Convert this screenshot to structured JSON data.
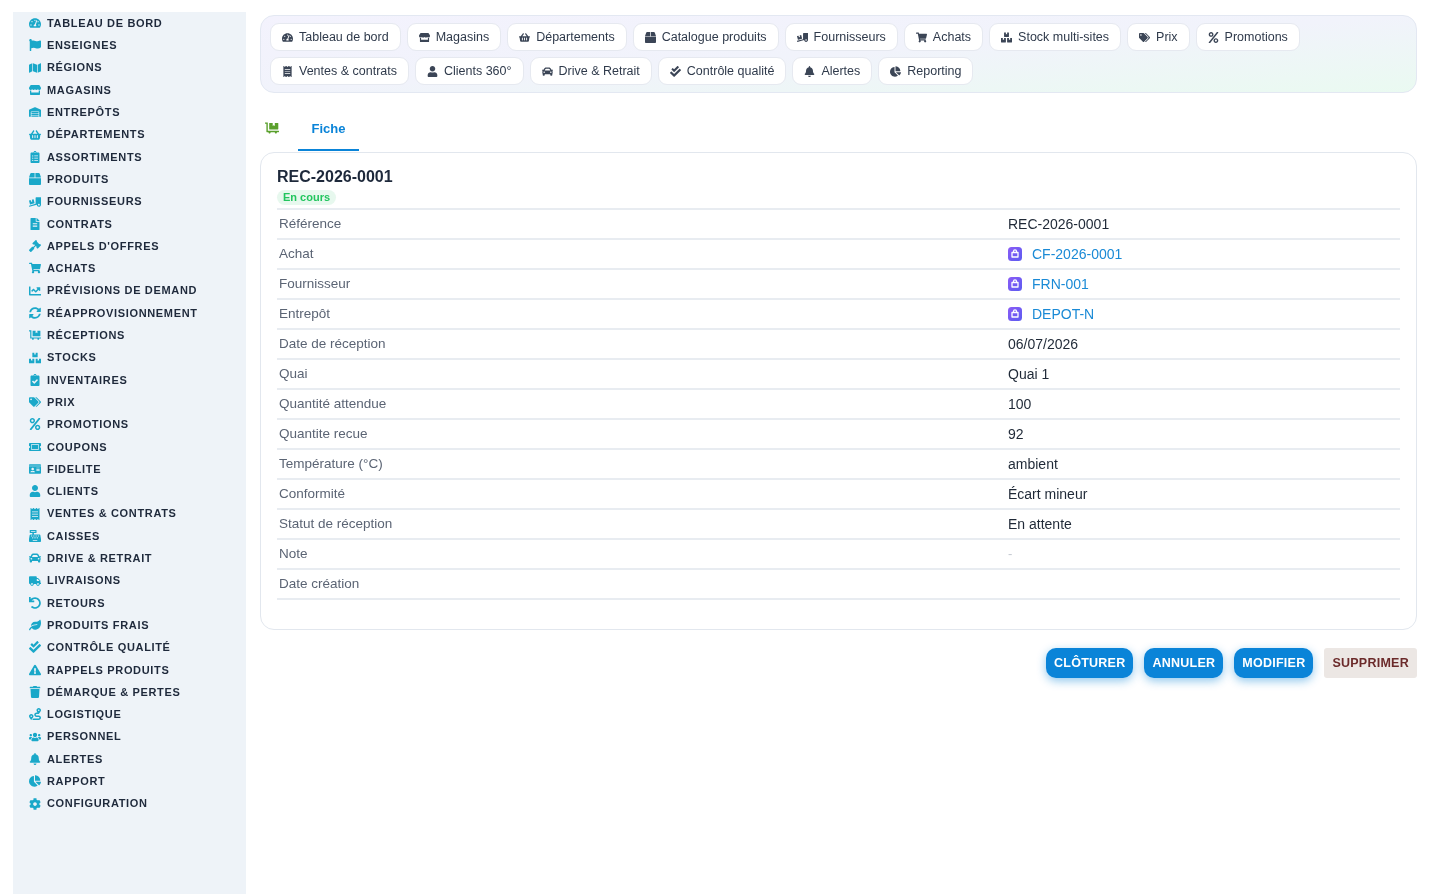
{
  "sidebar": {
    "items": [
      {
        "label": "TABLEAU DE BORD"
      },
      {
        "label": "ENSEIGNES"
      },
      {
        "label": "RÉGIONS"
      },
      {
        "label": "MAGASINS"
      },
      {
        "label": "ENTREPÔTS"
      },
      {
        "label": "DÉPARTEMENTS"
      },
      {
        "label": "ASSORTIMENTS"
      },
      {
        "label": "PRODUITS"
      },
      {
        "label": "FOURNISSEURS"
      },
      {
        "label": "CONTRATS"
      },
      {
        "label": "APPELS D'OFFRES"
      },
      {
        "label": "ACHATS"
      },
      {
        "label": "PRÉVISIONS DE DEMAND"
      },
      {
        "label": "RÉAPPROVISIONNEMENT"
      },
      {
        "label": "RÉCEPTIONS"
      },
      {
        "label": "STOCKS"
      },
      {
        "label": "INVENTAIRES"
      },
      {
        "label": "PRIX"
      },
      {
        "label": "PROMOTIONS"
      },
      {
        "label": "COUPONS"
      },
      {
        "label": "FIDELITE"
      },
      {
        "label": "CLIENTS"
      },
      {
        "label": "VENTES & CONTRATS"
      },
      {
        "label": "CAISSES"
      },
      {
        "label": "DRIVE & RETRAIT"
      },
      {
        "label": "LIVRAISONS"
      },
      {
        "label": "RETOURS"
      },
      {
        "label": "PRODUITS FRAIS"
      },
      {
        "label": "CONTRÔLE QUALITÉ"
      },
      {
        "label": "RAPPELS PRODUITS"
      },
      {
        "label": "DÉMARQUE & PERTES"
      },
      {
        "label": "LOGISTIQUE"
      },
      {
        "label": "PERSONNEL"
      },
      {
        "label": "ALERTES"
      },
      {
        "label": "RAPPORT"
      },
      {
        "label": "CONFIGURATION"
      }
    ]
  },
  "quick_nav": {
    "rows": [
      [
        {
          "label": "Tableau de bord"
        },
        {
          "label": "Magasins"
        },
        {
          "label": "Départements"
        },
        {
          "label": "Catalogue produits"
        },
        {
          "label": "Fournisseurs"
        },
        {
          "label": "Achats"
        },
        {
          "label": "Stock multi-sites"
        },
        {
          "label": "Prix"
        },
        {
          "label": "Promotions"
        }
      ],
      [
        {
          "label": "Ventes & contrats"
        },
        {
          "label": "Clients 360°"
        },
        {
          "label": "Drive & Retrait"
        },
        {
          "label": "Contrôle qualité"
        },
        {
          "label": "Alertes"
        },
        {
          "label": "Reporting"
        }
      ]
    ]
  },
  "tabs": [
    {
      "label": "Fiche",
      "selected": true
    }
  ],
  "record": {
    "title": "REC-2026-0001",
    "status": "En cours",
    "fields": [
      {
        "label": "Référence",
        "value": "REC-2026-0001",
        "kind": "text"
      },
      {
        "label": "Achat",
        "value": "CF-2026-0001",
        "kind": "link"
      },
      {
        "label": "Fournisseur",
        "value": "FRN-001",
        "kind": "link"
      },
      {
        "label": "Entrepôt",
        "value": "DEPOT-N",
        "kind": "link"
      },
      {
        "label": "Date de réception",
        "value": "06/07/2026",
        "kind": "text"
      },
      {
        "label": "Quai",
        "value": "Quai 1",
        "kind": "text"
      },
      {
        "label": "Quantité attendue",
        "value": "100",
        "kind": "text"
      },
      {
        "label": "Quantite recue",
        "value": "92",
        "kind": "text"
      },
      {
        "label": "Température (°C)",
        "value": "ambient",
        "kind": "text"
      },
      {
        "label": "Conformité",
        "value": "Écart mineur",
        "kind": "text"
      },
      {
        "label": "Statut de réception",
        "value": "En attente",
        "kind": "text"
      },
      {
        "label": "Note",
        "value": "-",
        "kind": "empty"
      },
      {
        "label": "Date création",
        "kind": "text"
      }
    ]
  },
  "actions": [
    {
      "label": "CLÔTURER",
      "kind": "primary"
    },
    {
      "label": "ANNULER",
      "kind": "primary"
    },
    {
      "label": "MODIFIER",
      "kind": "primary"
    },
    {
      "label": "SUPPRIMER",
      "kind": "danger"
    }
  ]
}
